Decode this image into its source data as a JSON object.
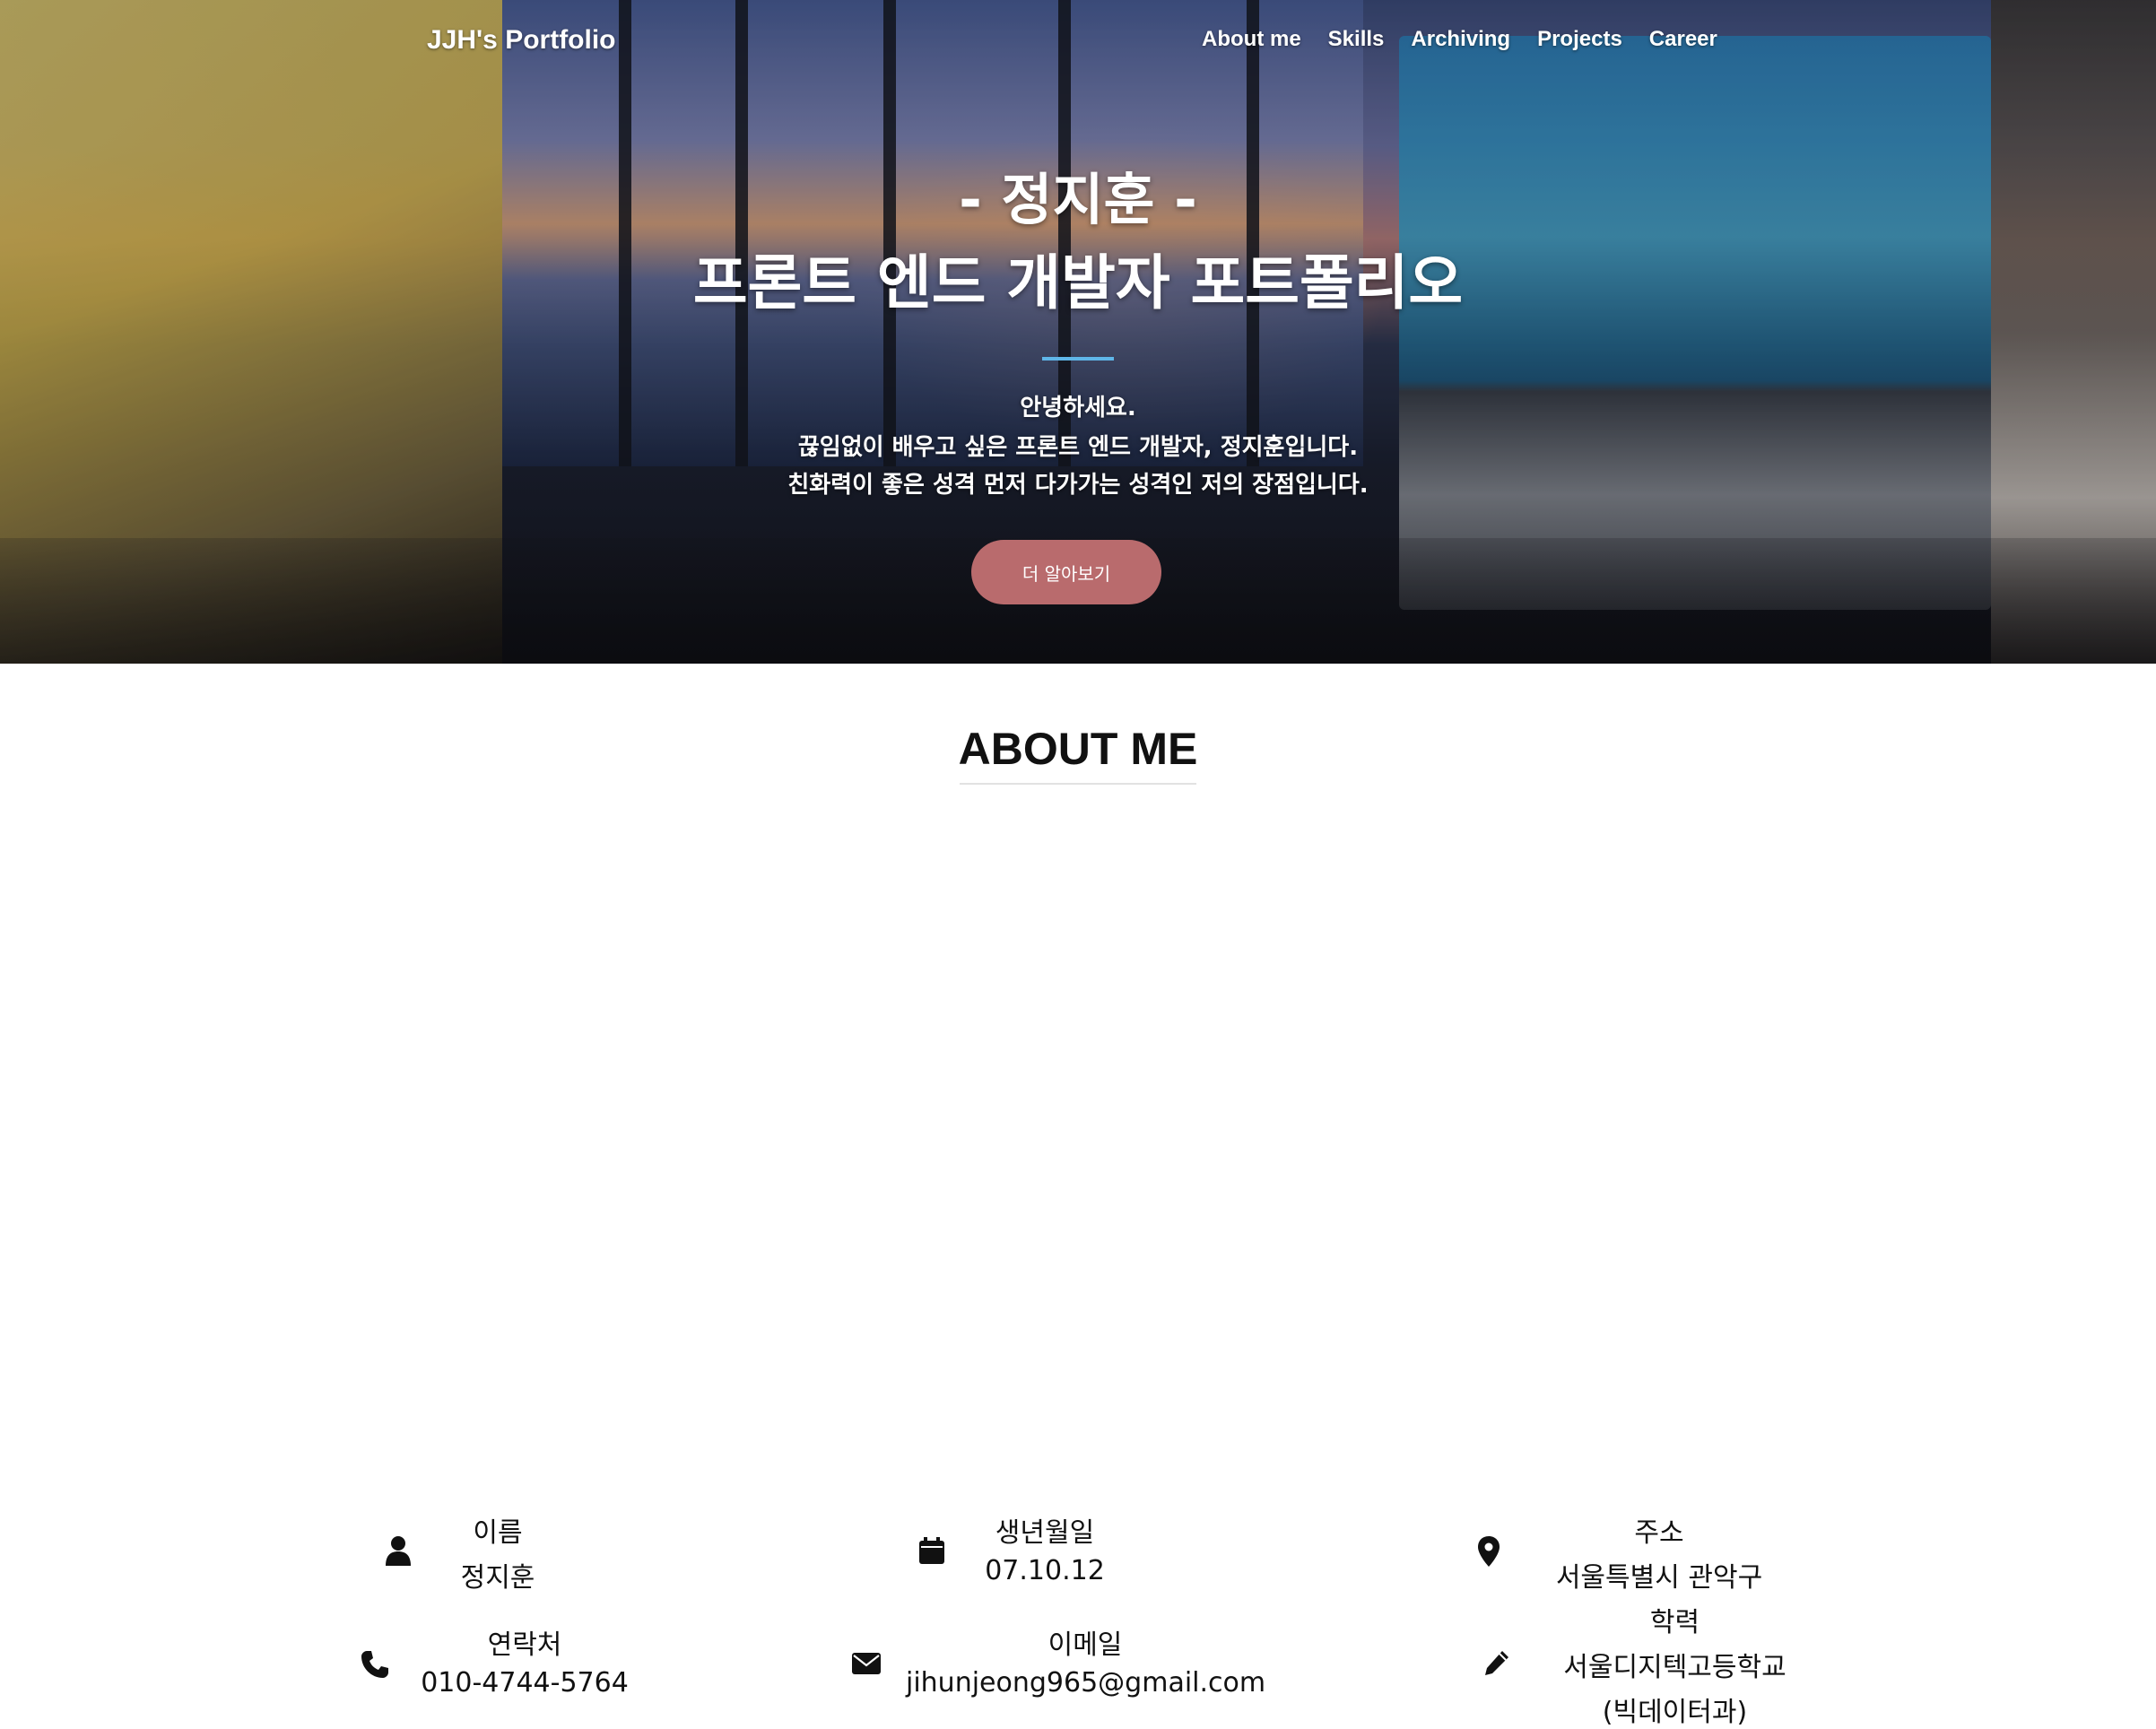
{
  "nav": {
    "brand": "JJH's Portfolio",
    "links": [
      "About me",
      "Skills",
      "Archiving",
      "Projects",
      "Career"
    ]
  },
  "hero": {
    "name_line": "- 정지훈 -",
    "title_line": "프론트 엔드 개발자 포트폴리오",
    "desc": [
      "안녕하세요.",
      "끊임없이 배우고 싶은 프론트 엔드 개발자, 정지훈입니다.",
      "친화력이 좋은 성격 먼저 다가가는 성격인 저의 장점입니다."
    ],
    "cta_label": "더 알아보기",
    "accent_color": "#5fb6e8",
    "cta_color": "#b96b6d"
  },
  "about": {
    "title": "ABOUT ME",
    "items": {
      "name": {
        "icon": "user-icon",
        "label": "이름",
        "value": "정지훈"
      },
      "birth": {
        "icon": "calendar-icon",
        "label": "생년월일",
        "value": "07.10.12"
      },
      "address": {
        "icon": "map-pin-icon",
        "label": "주소",
        "value": "서울특별시 관악구"
      },
      "phone": {
        "icon": "phone-icon",
        "label": "연락처",
        "value": "010-4744-5764"
      },
      "email": {
        "icon": "envelope-icon",
        "label": "이메일",
        "value": "jihunjeong965@gmail.com"
      },
      "education": {
        "icon": "pencil-icon",
        "label": "학력",
        "value": "서울디지텍고등학교",
        "value2": "(빅데이터과)"
      }
    }
  }
}
